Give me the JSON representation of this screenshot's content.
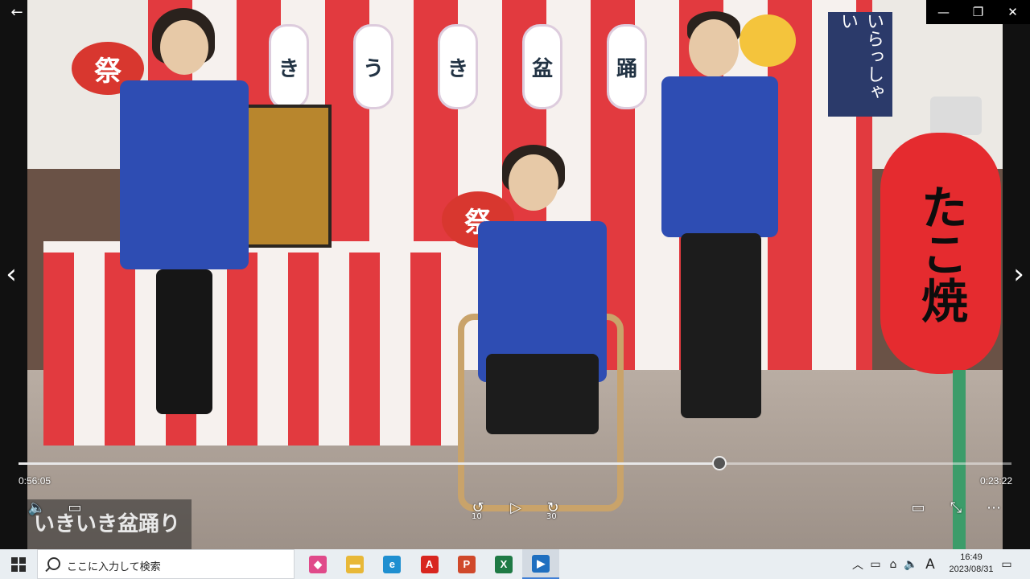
{
  "window": {
    "back_glyph": "←",
    "minimize_glyph": "—",
    "restore_glyph": "❐",
    "close_glyph": "✕",
    "prev_glyph": "‹",
    "next_glyph": "›"
  },
  "scene": {
    "lantern_tags": [
      "き",
      "う",
      "き",
      "盆",
      "踊"
    ],
    "fan_left": "祭",
    "fan_center": "祭",
    "fan_booth": "祭",
    "banner": "いらっしゃい",
    "lantern_text": "たこ焼"
  },
  "player": {
    "elapsed": "0:56:05",
    "remaining": "0:23:22",
    "progress_percent": 70.6,
    "caption": "いきいき盆踊り",
    "volume_icon": "🔈",
    "subtitles_icon": "▭",
    "skip_back_glyph": "↺",
    "skip_back_seconds": "10",
    "play_glyph": "▷",
    "skip_forward_glyph": "↻",
    "skip_forward_seconds": "30",
    "miniview_icon": "▭",
    "exit_fullscreen_icon": "⤡",
    "more_icon": "⋯"
  },
  "taskbar": {
    "search_placeholder": "ここに入力して検索",
    "apps": [
      {
        "name": "3d-viewer",
        "glyph": "◆",
        "color": "#e04a8a"
      },
      {
        "name": "file-explorer",
        "glyph": "▬",
        "color": "#e8b838"
      },
      {
        "name": "edge",
        "glyph": "e",
        "color": "#1f8fd0"
      },
      {
        "name": "acrobat",
        "glyph": "A",
        "color": "#d8261f"
      },
      {
        "name": "powerpoint",
        "glyph": "P",
        "color": "#d0492b"
      },
      {
        "name": "excel",
        "glyph": "X",
        "color": "#1f7a45"
      },
      {
        "name": "movies-tv",
        "glyph": "▶",
        "color": "#1f6fc0"
      }
    ],
    "tray": {
      "chevron": "︿",
      "battery": "▭",
      "network": "⌂",
      "volume": "🔈",
      "ime": "A"
    },
    "time": "16:49",
    "date": "2023/08/31",
    "notification_icon": "▭"
  }
}
